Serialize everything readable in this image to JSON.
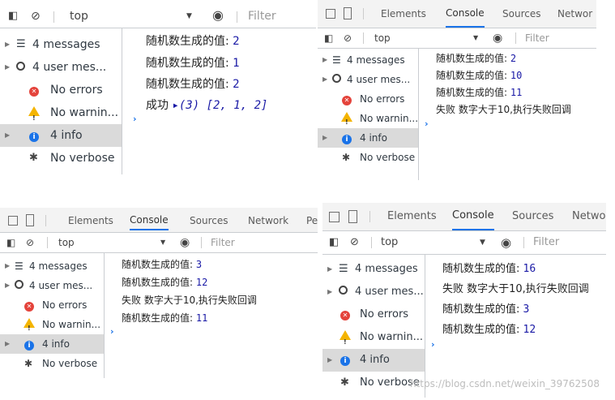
{
  "panels": [
    {
      "toolbar": {
        "context": "top",
        "filter_placeholder": "Filter"
      },
      "sidebar": {
        "messages": "4 messages",
        "user_messages": "4 user mes...",
        "errors": "No errors",
        "warnings": "No warnin...",
        "info": "4 info",
        "verbose": "No verbose"
      },
      "logs": [
        {
          "label": "随机数生成的值:",
          "value": "2"
        },
        {
          "label": "随机数生成的值:",
          "value": "1"
        },
        {
          "label": "随机数生成的值:",
          "value": "2"
        },
        {
          "label": "成功",
          "value": "▸(3) [2, 1, 2]"
        }
      ]
    },
    {
      "tabs": [
        "Elements",
        "Console",
        "Sources",
        "Networ"
      ],
      "toolbar": {
        "context": "top",
        "filter_placeholder": "Filter"
      },
      "sidebar": {
        "messages": "4 messages",
        "user_messages": "4 user mes...",
        "errors": "No errors",
        "warnings": "No warnin...",
        "info": "4 info",
        "verbose": "No verbose"
      },
      "logs": [
        {
          "label": "随机数生成的值:",
          "value": "2"
        },
        {
          "label": "随机数生成的值:",
          "value": "10"
        },
        {
          "label": "随机数生成的值:",
          "value": "11"
        },
        {
          "label": "失败 数字大于10,执行失败回调",
          "value": ""
        }
      ]
    },
    {
      "tabs": [
        "Elements",
        "Console",
        "Sources",
        "Network",
        "Pe"
      ],
      "toolbar": {
        "context": "top",
        "filter_placeholder": "Filter"
      },
      "sidebar": {
        "messages": "4 messages",
        "user_messages": "4 user mes...",
        "errors": "No errors",
        "warnings": "No warnin...",
        "info": "4 info",
        "verbose": "No verbose"
      },
      "logs": [
        {
          "label": "随机数生成的值:",
          "value": "3"
        },
        {
          "label": "随机数生成的值:",
          "value": "12"
        },
        {
          "label": "失败 数字大于10,执行失败回调",
          "value": ""
        },
        {
          "label": "随机数生成的值:",
          "value": "11"
        }
      ]
    },
    {
      "tabs": [
        "Elements",
        "Console",
        "Sources",
        "Networ"
      ],
      "toolbar": {
        "context": "top",
        "filter_placeholder": "Filter"
      },
      "sidebar": {
        "messages": "4 messages",
        "user_messages": "4 user mes...",
        "errors": "No errors",
        "warnings": "No warnin...",
        "info": "4 info",
        "verbose": "No verbose"
      },
      "logs": [
        {
          "label": "随机数生成的值:",
          "value": "16"
        },
        {
          "label": "失败 数字大于10,执行失败回调",
          "value": ""
        },
        {
          "label": "随机数生成的值:",
          "value": "3"
        },
        {
          "label": "随机数生成的值:",
          "value": "12"
        }
      ]
    }
  ],
  "watermark": "https://blog.csdn.net/weixin_39762508",
  "colors": {
    "accent": "#1a73e8",
    "number": "#1a1aa6",
    "selected_row": "#dadada",
    "error": "#e4433b",
    "warning": "#f4b400"
  }
}
